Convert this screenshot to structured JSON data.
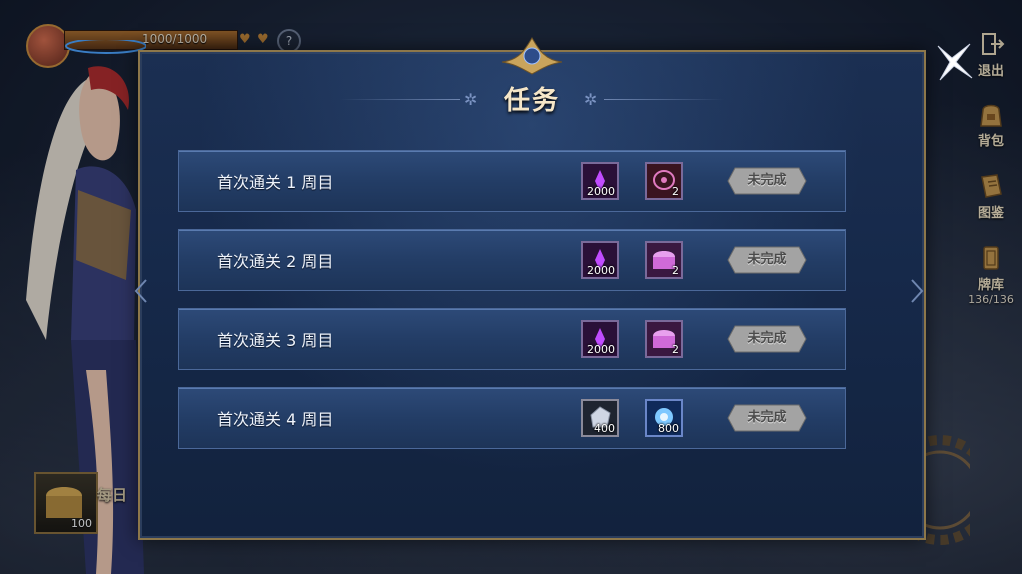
{
  "hud": {
    "hp_text": "1000/1000",
    "help_icon": "?"
  },
  "side_menu": {
    "items": [
      {
        "label": "退出",
        "icon": "exit-icon"
      },
      {
        "label": "背包",
        "icon": "backpack-icon"
      },
      {
        "label": "图鉴",
        "icon": "book-icon"
      },
      {
        "label": "牌库",
        "icon": "card-deck-icon",
        "count": "136/136"
      }
    ]
  },
  "daily": {
    "label": "每日",
    "chest_qty": "100"
  },
  "modal": {
    "title": "任务",
    "tasks": [
      {
        "label": "首次通关 1 周目",
        "rewards": [
          {
            "icon": "purple-crystal-icon",
            "qty": "2000"
          },
          {
            "icon": "purple-emblem-icon",
            "qty": "2"
          }
        ],
        "status": "未完成"
      },
      {
        "label": "首次通关 2 周目",
        "rewards": [
          {
            "icon": "purple-crystal-icon",
            "qty": "2000"
          },
          {
            "icon": "treasure-chest-icon",
            "qty": "2"
          }
        ],
        "status": "未完成"
      },
      {
        "label": "首次通关 3 周目",
        "rewards": [
          {
            "icon": "purple-crystal-icon",
            "qty": "2000"
          },
          {
            "icon": "treasure-chest-icon",
            "qty": "2"
          }
        ],
        "status": "未完成"
      },
      {
        "label": "首次通关 4 周目",
        "rewards": [
          {
            "icon": "silver-gem-icon",
            "qty": "400"
          },
          {
            "icon": "blue-orb-icon",
            "qty": "800"
          }
        ],
        "status": "未完成"
      }
    ]
  },
  "colors": {
    "accent_gold": "#8d774a",
    "panel_blue": "#1b2f52",
    "row_blue": "#2d4a78",
    "status_gray": "#9a9a9a"
  }
}
